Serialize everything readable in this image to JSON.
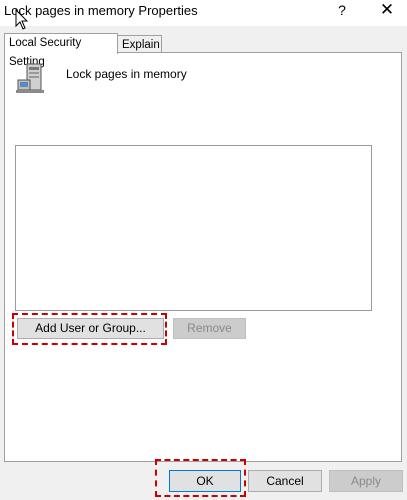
{
  "window": {
    "title": "Lock pages in memory Properties",
    "help_glyph": "?",
    "close_glyph": "✕"
  },
  "tabs": [
    {
      "label": "Local Security Setting",
      "active": true
    },
    {
      "label": "Explain",
      "active": false
    }
  ],
  "policy": {
    "name": "Lock pages in memory",
    "icon": "server-computer-icon"
  },
  "members_list": {
    "items": []
  },
  "buttons": {
    "add": "Add User or Group...",
    "remove": "Remove",
    "ok": "OK",
    "cancel": "Cancel",
    "apply": "Apply"
  },
  "colors": {
    "highlight": "#cc0000",
    "accent": "#0078d7"
  }
}
